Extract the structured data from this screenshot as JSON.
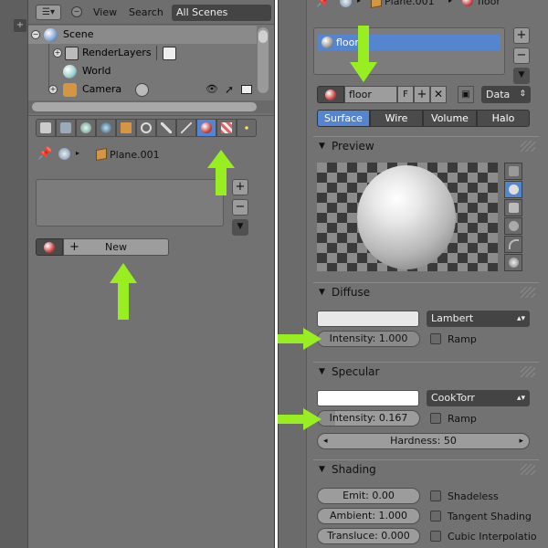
{
  "outliner": {
    "menu_view": "View",
    "menu_search": "Search",
    "scene_select": "All Scenes",
    "tree": {
      "scene": "Scene",
      "renderlayers": "RenderLayers",
      "world": "World",
      "camera": "Camera"
    }
  },
  "left_context": {
    "object": "Plane.001"
  },
  "left_slot": {
    "new_label": "New"
  },
  "right_context": {
    "object": "Plane.001",
    "material": "floor"
  },
  "right_slot": {
    "item": "floor"
  },
  "material": {
    "name": "floor",
    "fake_user": "F",
    "data_select": "Data"
  },
  "type_tabs": [
    "Surface",
    "Wire",
    "Volume",
    "Halo"
  ],
  "panels": {
    "preview": "Preview",
    "diffuse": "Diffuse",
    "specular": "Specular",
    "shading": "Shading"
  },
  "diffuse": {
    "shader": "Lambert",
    "intensity_label": "Intensity: 1.000",
    "intensity": 1.0,
    "ramp": "Ramp"
  },
  "specular": {
    "shader": "CookTorr",
    "intensity_label": "Intensity: 0.167",
    "intensity": 0.167,
    "ramp": "Ramp",
    "hardness_label": "Hardness: 50"
  },
  "shading": {
    "emit": "Emit: 0.00",
    "ambient": "Ambient: 1.000",
    "transluce": "Transluce: 0.000",
    "shadeless": "Shadeless",
    "tangent": "Tangent Shading",
    "cubic": "Cubic Interpolatio"
  },
  "colors": {
    "accent": "#5685cf",
    "panel_bg": "#727272",
    "arrow": "#99ee22"
  }
}
